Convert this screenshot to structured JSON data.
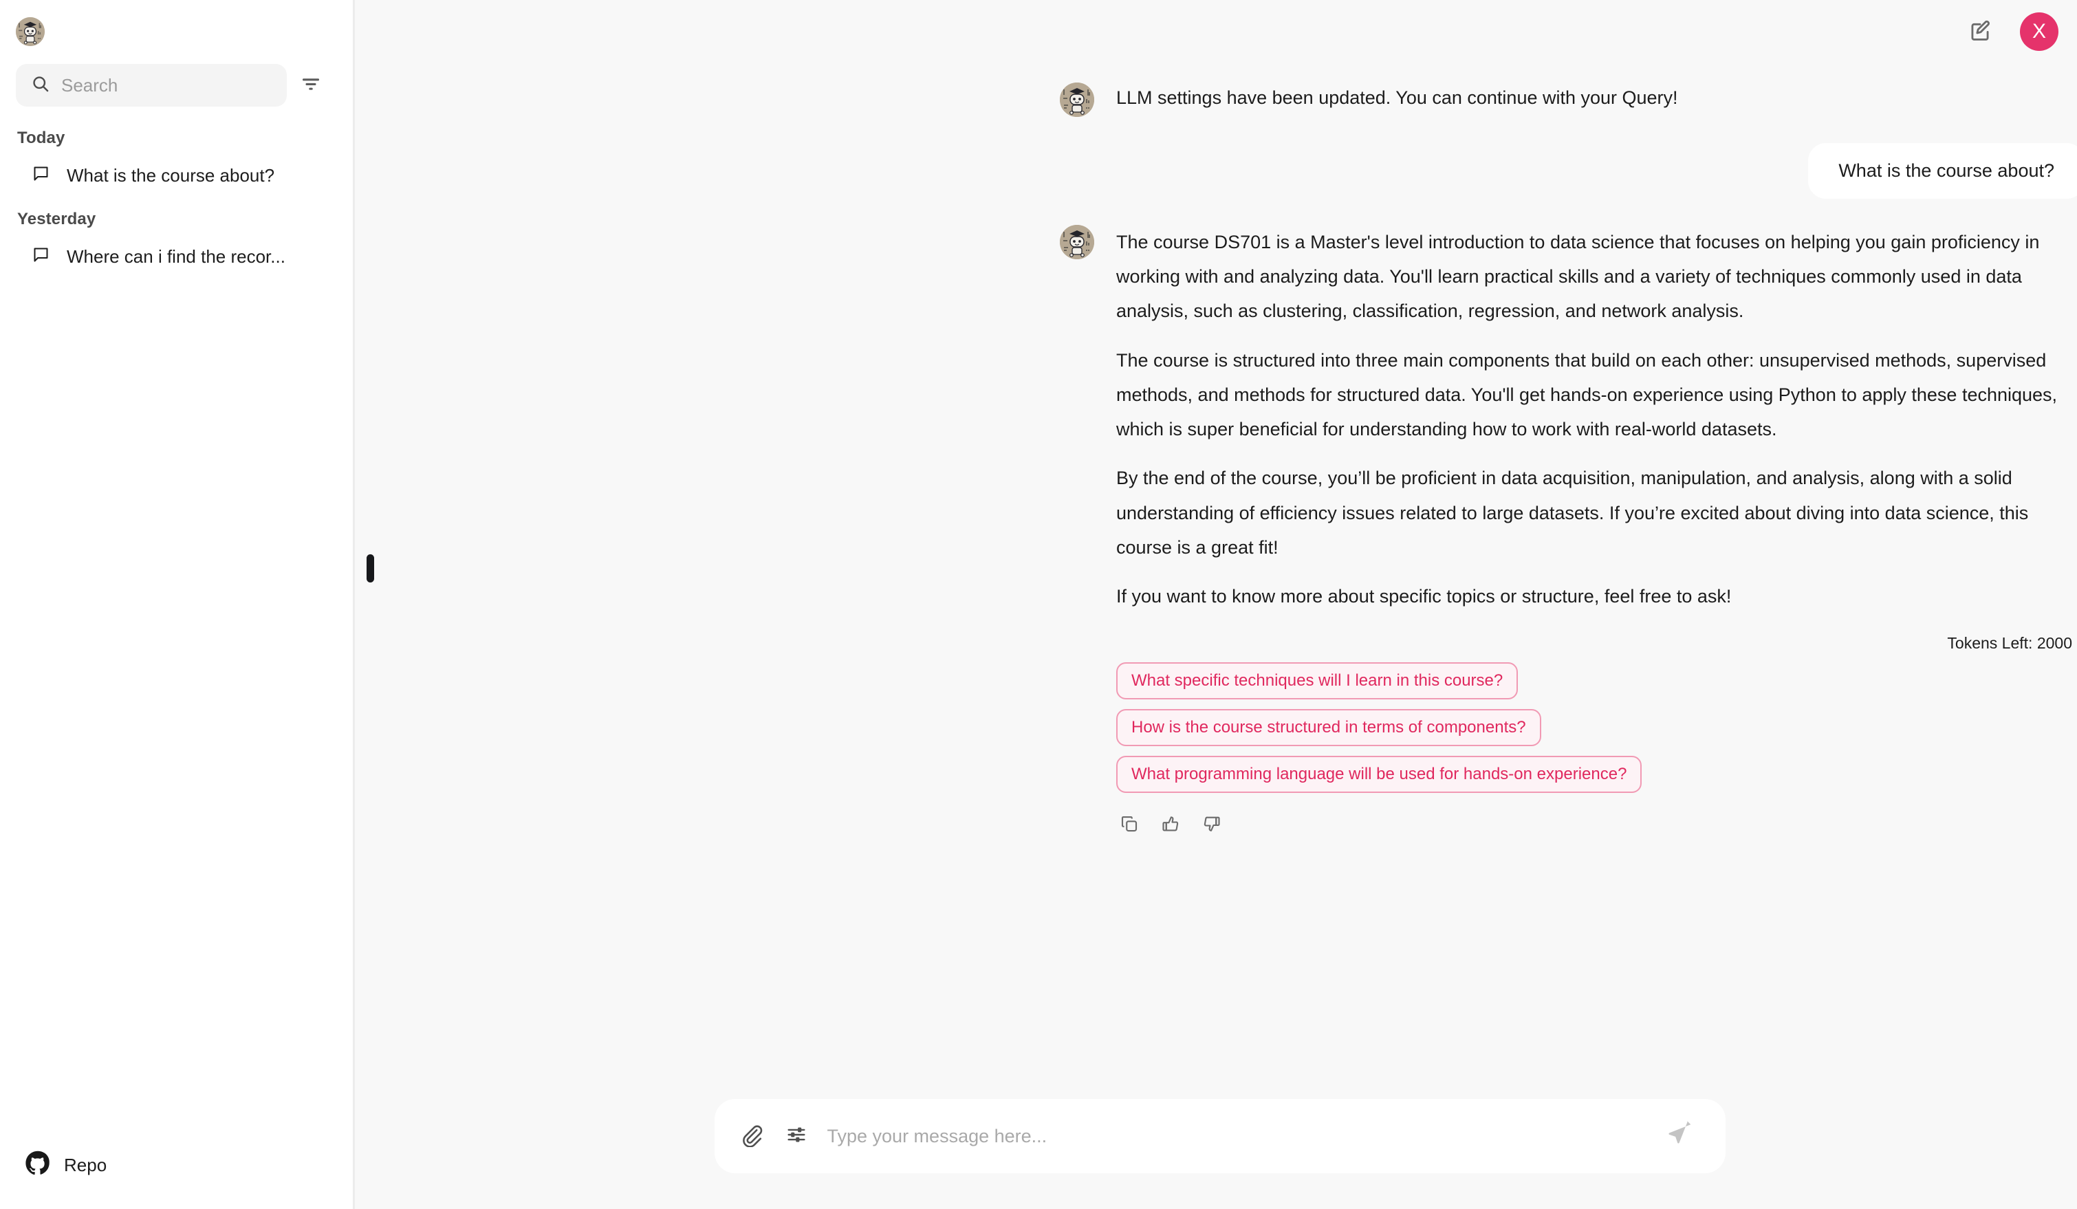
{
  "sidebar": {
    "logo_icon": "robot-graduate-avatar",
    "search": {
      "value": "",
      "placeholder": "Search"
    },
    "filter_icon": "filter-icon",
    "groups": [
      {
        "label": "Today",
        "items": [
          {
            "label": "What is the course about?",
            "icon": "chat-bubble-icon"
          }
        ]
      },
      {
        "label": "Yesterday",
        "items": [
          {
            "label": "Where can i find the recor...",
            "icon": "chat-bubble-icon"
          }
        ]
      }
    ],
    "footer": {
      "label": "Repo",
      "icon": "github-icon"
    }
  },
  "topbar": {
    "edit_icon": "edit-square-icon",
    "avatar_letter": "X",
    "avatar_color": "#e5336b"
  },
  "conversation": {
    "messages": [
      {
        "role": "assistant",
        "avatar_icon": "robot-graduate-avatar",
        "text": "LLM settings have been updated. You can continue with your Query!"
      },
      {
        "role": "user",
        "text": "What is the course about?"
      },
      {
        "role": "assistant",
        "avatar_icon": "robot-graduate-avatar",
        "paragraphs": [
          "The course DS701 is a Master's level introduction to data science that focuses on helping you gain proficiency in working with and analyzing data. You'll learn practical skills and a variety of techniques commonly used in data analysis, such as clustering, classification, regression, and network analysis.",
          "The course is structured into three main components that build on each other: unsupervised methods, supervised methods, and methods for structured data. You'll get hands-on experience using Python to apply these techniques, which is super beneficial for understanding how to work with real-world datasets.",
          "By the end of the course, you’ll be proficient in data acquisition, manipulation, and analysis, along with a solid understanding of efficiency issues related to large datasets. If you’re excited about diving into data science, this course is a great fit!",
          "If you want to know more about specific topics or structure, feel free to ask!"
        ]
      }
    ],
    "tokens_left": "Tokens Left: 2000",
    "suggestions": [
      "What specific techniques will I learn in this course?",
      "How is the course structured in terms of components?",
      "What programming language will be used for hands-on experience?"
    ],
    "actions": [
      {
        "icon": "copy-icon"
      },
      {
        "icon": "thumbs-up-icon"
      },
      {
        "icon": "thumbs-down-icon"
      }
    ]
  },
  "composer": {
    "attach_icon": "paperclip-icon",
    "settings_icon": "sliders-icon",
    "input": {
      "value": "",
      "placeholder": "Type your message here..."
    },
    "send_icon": "send-icon"
  },
  "colors": {
    "accent": "#e0285e",
    "avatar": "#e5336b",
    "chip_border": "#f19ab4",
    "chip_bg": "#fdf3f6",
    "main_bg": "#f8f8f8",
    "sidebar_bg": "#ffffff"
  }
}
